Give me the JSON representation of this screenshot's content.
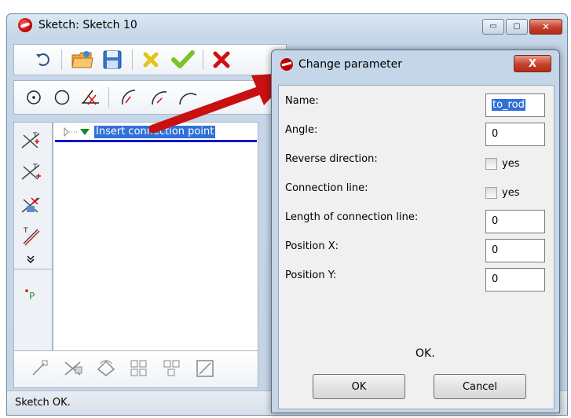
{
  "main_window": {
    "title": "Sketch: Sketch 10",
    "controls": {
      "minimize": "▭",
      "maximize": "▢",
      "close": "✕"
    },
    "tree": {
      "selected_item": "Insert connection point"
    },
    "status_bar": "Sketch OK."
  },
  "dialog": {
    "title": "Change parameter",
    "close_symbol": "X",
    "params": [
      {
        "label": "Name:",
        "value": "to_rod"
      },
      {
        "label": "Angle:",
        "value": "0"
      },
      {
        "label": "Reverse direction:",
        "check_label": "yes",
        "checked": false
      },
      {
        "label": "Connection line:",
        "check_label": "yes",
        "checked": false
      },
      {
        "label": "Length of connection line:",
        "value": "0"
      },
      {
        "label": "Position X:",
        "value": "0"
      },
      {
        "label": "Position Y:",
        "value": "0"
      }
    ],
    "status": "OK.",
    "ok_label": "OK",
    "cancel_label": "Cancel"
  },
  "colors": {
    "title_glass": "#c5d6e9",
    "selection": "#3070d8",
    "arrow": "#c81010",
    "accept_check": "#7cc22a",
    "reject_x": "#d01010"
  },
  "icons": [
    "undo-icon",
    "open-folder-icon",
    "save-icon",
    "delete-icon",
    "accept-check-icon",
    "cancel-x-icon",
    "point-icon",
    "circle-icon",
    "angle-icon",
    "arc-icon"
  ]
}
